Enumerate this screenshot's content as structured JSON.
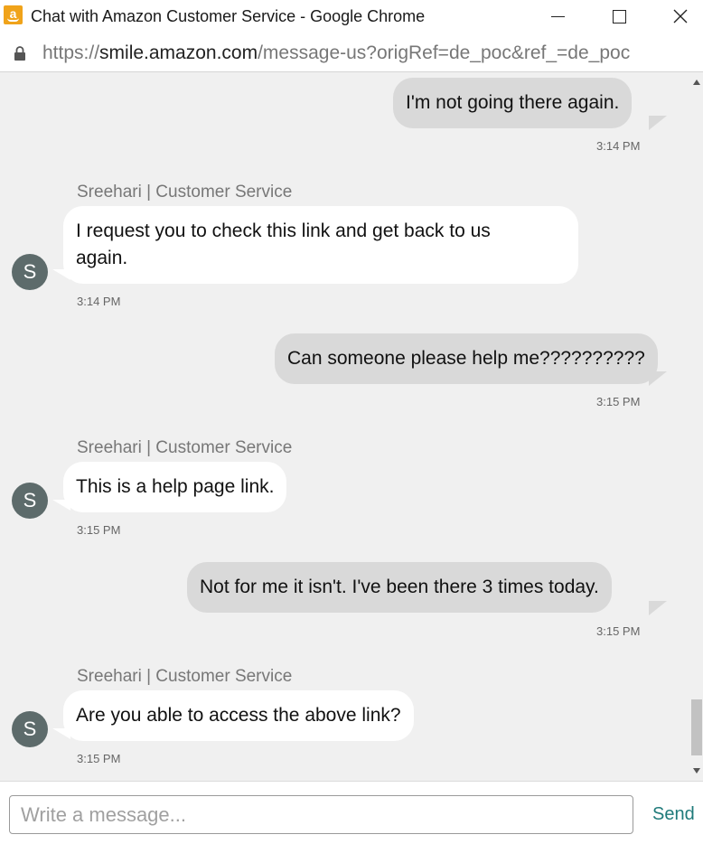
{
  "window": {
    "title": "Chat with Amazon Customer Service - Google Chrome",
    "app_icon_letter": "a"
  },
  "address": {
    "scheme": "https://",
    "host": "smile.amazon.com",
    "path": "/message-us?origRef=de_poc&ref_=de_poc"
  },
  "messages": [
    {
      "type": "out",
      "text": "I'm not going there again.",
      "time": "3:14 PM"
    },
    {
      "type": "in",
      "sender": "Sreehari | Customer Service",
      "avatar": "S",
      "line1": "I request you to check this link and get back to us",
      "line2": "again.",
      "time": "3:14 PM"
    },
    {
      "type": "out",
      "text": "Can someone please help me??????????",
      "time": "3:15 PM"
    },
    {
      "type": "in",
      "sender": "Sreehari | Customer Service",
      "avatar": "S",
      "text": "This is a help page link.",
      "time": "3:15 PM"
    },
    {
      "type": "out",
      "text": "Not for me it isn't. I've been there 3 times today.",
      "time": "3:15 PM"
    },
    {
      "type": "in",
      "sender": "Sreehari | Customer Service",
      "avatar": "S",
      "text": "Are you able to access the above link?",
      "time": "3:15 PM"
    }
  ],
  "composer": {
    "placeholder": "Write a message...",
    "value": "",
    "send_label": "Send"
  },
  "colors": {
    "outgoing_bubble": "#d9d9d9",
    "incoming_bubble": "#ffffff",
    "avatar": "#5d6b6b",
    "send_button": "#1f7a7a",
    "amazon_orange": "#f0a31a"
  }
}
